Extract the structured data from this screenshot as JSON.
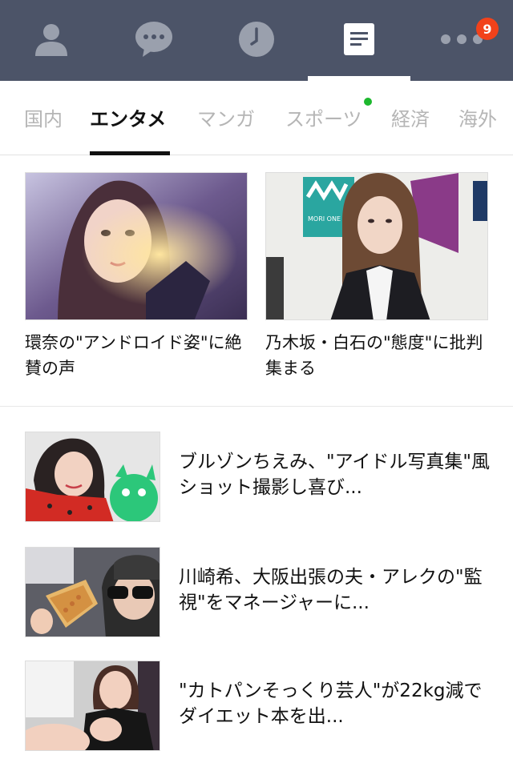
{
  "topnav": {
    "tabs": [
      {
        "icon": "friends-icon"
      },
      {
        "icon": "chat-icon"
      },
      {
        "icon": "timeline-icon"
      },
      {
        "icon": "news-icon"
      },
      {
        "icon": "more-icon"
      }
    ],
    "active_tab": 3,
    "more_badge": "9",
    "colors": {
      "bar": "#4c5468",
      "badge": "#f2421b"
    }
  },
  "categories": {
    "tabs": [
      "国内",
      "エンタメ",
      "マンガ",
      "スポーツ",
      "経済",
      "海外"
    ],
    "active": "エンタメ",
    "new_indicator_on": "スポーツ"
  },
  "featured": [
    {
      "title": "環奈の\"アンドロイド姿\"に絶賛の声"
    },
    {
      "title": "乃木坂・白石の\"態度\"に批判集まる",
      "image_sign_text": "MORI ONE WORLD"
    }
  ],
  "list": [
    {
      "title": "ブルゾンちえみ、\"アイドル写真集\"風ショット撮影し喜び..."
    },
    {
      "title": "川崎希、大阪出張の夫・アレクの\"監視\"をマネージャーに..."
    },
    {
      "title": "\"カトパンそっくり芸人\"が22kg減でダイエット本を出..."
    }
  ]
}
